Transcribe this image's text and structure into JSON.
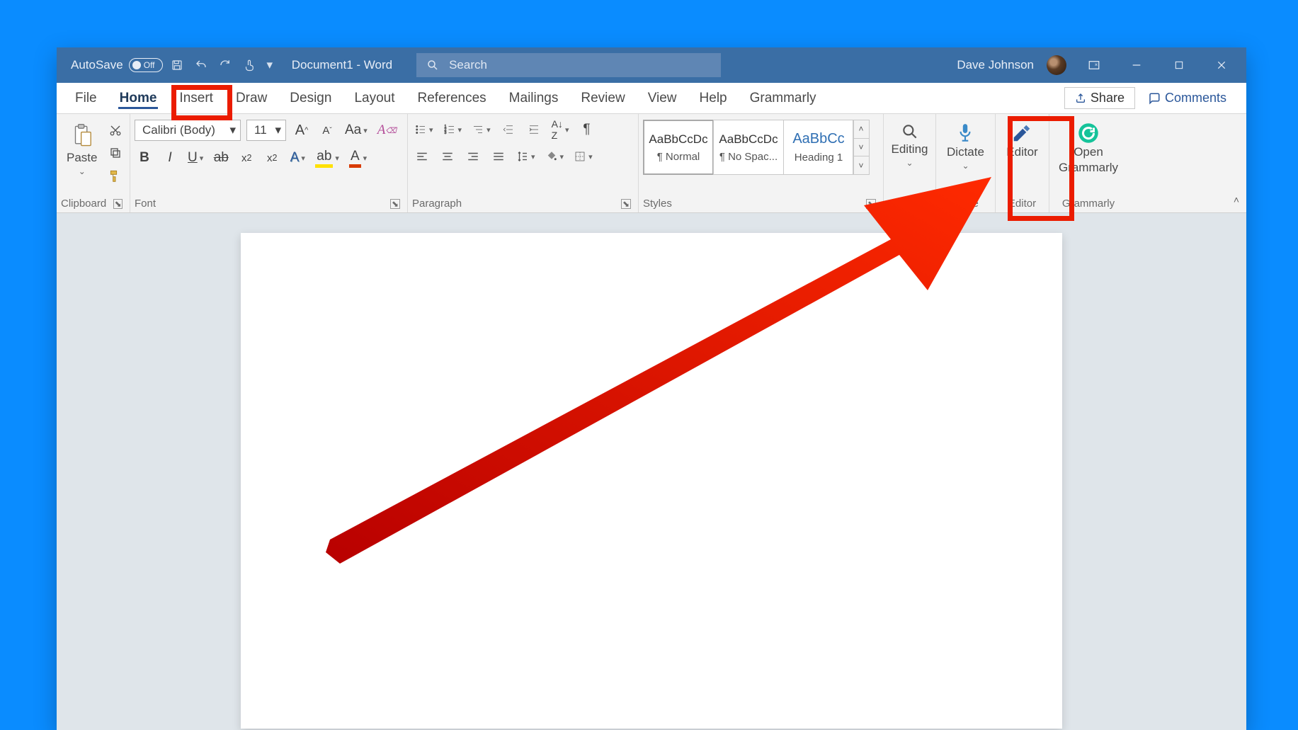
{
  "titlebar": {
    "autosave_label": "AutoSave",
    "autosave_state": "Off",
    "doc_title": "Document1  -  Word",
    "search_placeholder": "Search",
    "user_name": "Dave Johnson"
  },
  "tabs": {
    "file": "File",
    "home": "Home",
    "insert": "Insert",
    "draw": "Draw",
    "design": "Design",
    "layout": "Layout",
    "references": "References",
    "mailings": "Mailings",
    "review": "Review",
    "view": "View",
    "help": "Help",
    "grammarly": "Grammarly",
    "share": "Share",
    "comments": "Comments"
  },
  "ribbon": {
    "clipboard": {
      "paste": "Paste",
      "label": "Clipboard"
    },
    "font": {
      "name": "Calibri (Body)",
      "size": "11",
      "case": "Aa",
      "label": "Font"
    },
    "paragraph": {
      "label": "Paragraph"
    },
    "styles": {
      "s1_preview": "AaBbCcDc",
      "s1_name": "¶ Normal",
      "s2_preview": "AaBbCcDc",
      "s2_name": "¶ No Spac...",
      "s3_preview": "AaBbCc",
      "s3_name": "Heading 1",
      "label": "Styles"
    },
    "editing": {
      "label": "Editing"
    },
    "voice": {
      "dictate": "Dictate",
      "label": "Voice"
    },
    "editor": {
      "btn": "Editor",
      "label": "Editor"
    },
    "grammarly": {
      "btn1": "Open",
      "btn2": "Grammarly",
      "label": "Grammarly"
    }
  }
}
